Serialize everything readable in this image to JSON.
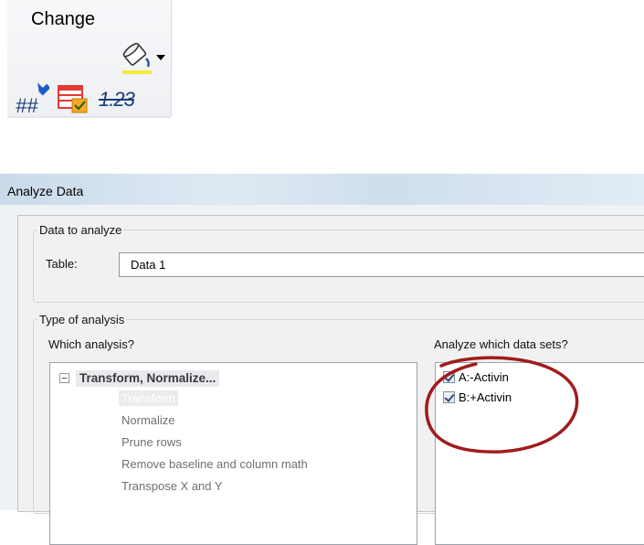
{
  "ribbon": {
    "title": "Change",
    "buttons": [
      {
        "name": "paint-bucket",
        "icon": "paint-bucket-icon"
      },
      {
        "name": "number-format",
        "icon": "hash-arrow-icon"
      },
      {
        "name": "table-check",
        "icon": "table-check-icon"
      },
      {
        "name": "decimal-format",
        "icon": "decimal-icon",
        "text": "1.23"
      }
    ]
  },
  "dialog": {
    "title": "Analyze Data",
    "data_group": {
      "legend": "Data to analyze",
      "table_label": "Table:",
      "table_value": "Data 1"
    },
    "analysis_group": {
      "legend": "Type of analysis",
      "which_analysis_label": "Which analysis?",
      "which_sets_label": "Analyze which data sets?",
      "category": "Transform, Normalize...",
      "items": [
        {
          "label": "Transform",
          "selected": true
        },
        {
          "label": "Normalize",
          "selected": false
        },
        {
          "label": "Prune rows",
          "selected": false
        },
        {
          "label": "Remove baseline and column math",
          "selected": false
        },
        {
          "label": "Transpose X and Y",
          "selected": false
        }
      ],
      "data_sets": [
        {
          "label": "A:-Activin",
          "checked": true
        },
        {
          "label": "B:+Activin",
          "checked": true
        }
      ]
    }
  },
  "colors": {
    "highlight_circle": "#a01c1c",
    "title_bar": "#cfdeec",
    "paint_underline": "#f2ea3a"
  }
}
